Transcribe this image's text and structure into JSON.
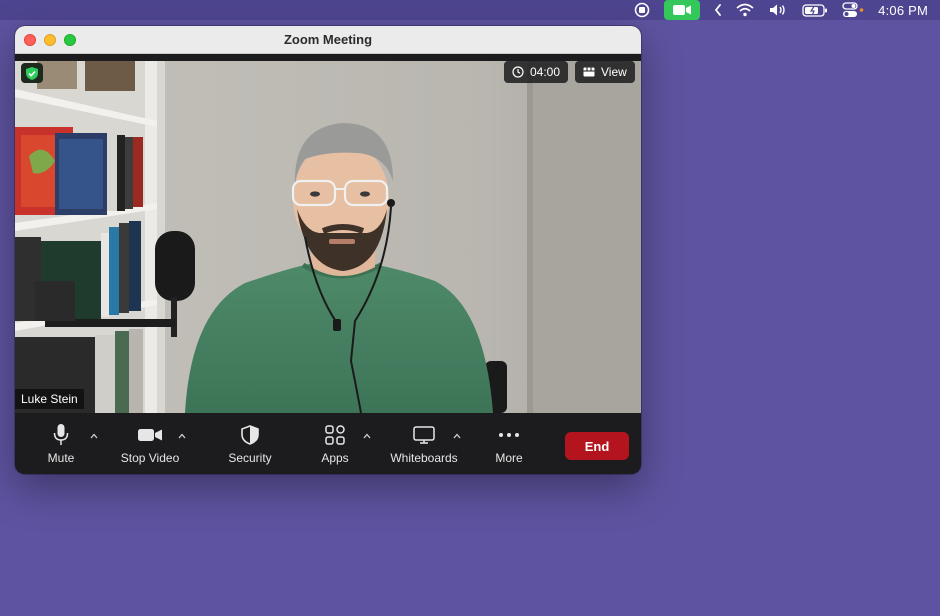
{
  "menubar": {
    "time": "4:06 PM",
    "icons": [
      "record-stop-icon",
      "camera-icon",
      "chevron-left-icon",
      "wifi-icon",
      "volume-icon",
      "battery-icon",
      "control-center-icon"
    ],
    "accent_green": "#34c759"
  },
  "window": {
    "title": "Zoom Meeting"
  },
  "video": {
    "participant_name": "Luke Stein",
    "timer": "04:00",
    "view_label": "View"
  },
  "toolbar": {
    "mute_label": "Mute",
    "stop_video_label": "Stop Video",
    "security_label": "Security",
    "apps_label": "Apps",
    "whiteboards_label": "Whiteboards",
    "more_label": "More",
    "end_label": "End",
    "end_color": "#b3141e"
  },
  "colors": {
    "desktop": "#5e53a0",
    "toolbar": "#1c1c1e"
  }
}
